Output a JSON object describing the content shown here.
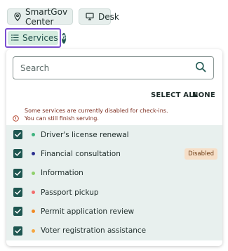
{
  "toolbar": {
    "location_chip": {
      "label": "SmartGov Center",
      "icon": "map-pin-icon"
    },
    "desk_chip": {
      "label": "Desk",
      "icon": "monitor-icon"
    },
    "services_button": {
      "label": "Services",
      "count": "6",
      "icon": "list-icon"
    }
  },
  "panel": {
    "search": {
      "placeholder": "Search",
      "icon": "search-icon"
    },
    "actions": {
      "select_all": "SELECT ALL",
      "select_none": "NONE"
    },
    "notice": {
      "line1": "Some services are currently disabled for check-ins.",
      "line2": "You can still finish serving.",
      "icon": "alert-circle-icon"
    },
    "services": [
      {
        "label": "Driver's license renewal",
        "checked": true,
        "dot_color": "#3fb37f",
        "badge": ""
      },
      {
        "label": "Financial consultation",
        "checked": true,
        "dot_color": "#2b2f8f",
        "badge": "Disabled"
      },
      {
        "label": "Information",
        "checked": true,
        "dot_color": "#8fd06b",
        "badge": ""
      },
      {
        "label": "Passport pickup",
        "checked": true,
        "dot_color": "#f26d6d",
        "badge": ""
      },
      {
        "label": "Permit application review",
        "checked": true,
        "dot_color": "#f08a24",
        "badge": ""
      },
      {
        "label": "Voter registration assistance",
        "checked": true,
        "dot_color": "#f5a742",
        "badge": ""
      }
    ]
  },
  "colors": {
    "accent": "#1e5650",
    "focus_outline": "#7b4fd1",
    "list_background": "#e8f0ee",
    "disabled_badge_bg": "#f6dfc8",
    "notice_text": "#7a2a1c"
  }
}
